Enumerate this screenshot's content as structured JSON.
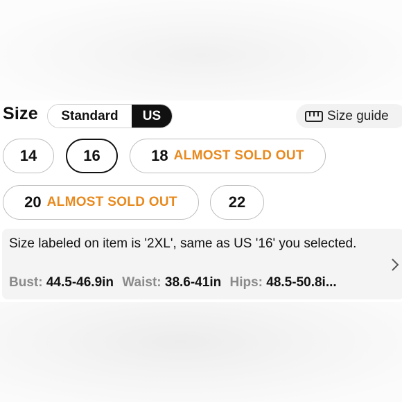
{
  "header": {
    "title": "Size"
  },
  "toggle": {
    "standard_label": "Standard",
    "us_label": "US",
    "selected": "US"
  },
  "size_guide": {
    "label": "Size guide",
    "icon": "ruler-icon"
  },
  "sizes": [
    {
      "num": "14",
      "badge": ""
    },
    {
      "num": "16",
      "badge": "",
      "selected": true
    },
    {
      "num": "18",
      "badge": "ALMOST SOLD OUT"
    },
    {
      "num": "20",
      "badge": "ALMOST SOLD OUT"
    },
    {
      "num": "22",
      "badge": ""
    }
  ],
  "info": {
    "text": "Size labeled on item is '2XL', same as US '16' you selected.",
    "bust_label": "Bust:",
    "bust_value": "44.5-46.9in",
    "waist_label": "Waist:",
    "waist_value": "38.6-41in",
    "hips_label": "Hips:",
    "hips_value": "48.5-50.8i..."
  },
  "colors": {
    "accent": "#e8891e",
    "selected_bg": "#111111",
    "muted": "#8a8a8a"
  }
}
